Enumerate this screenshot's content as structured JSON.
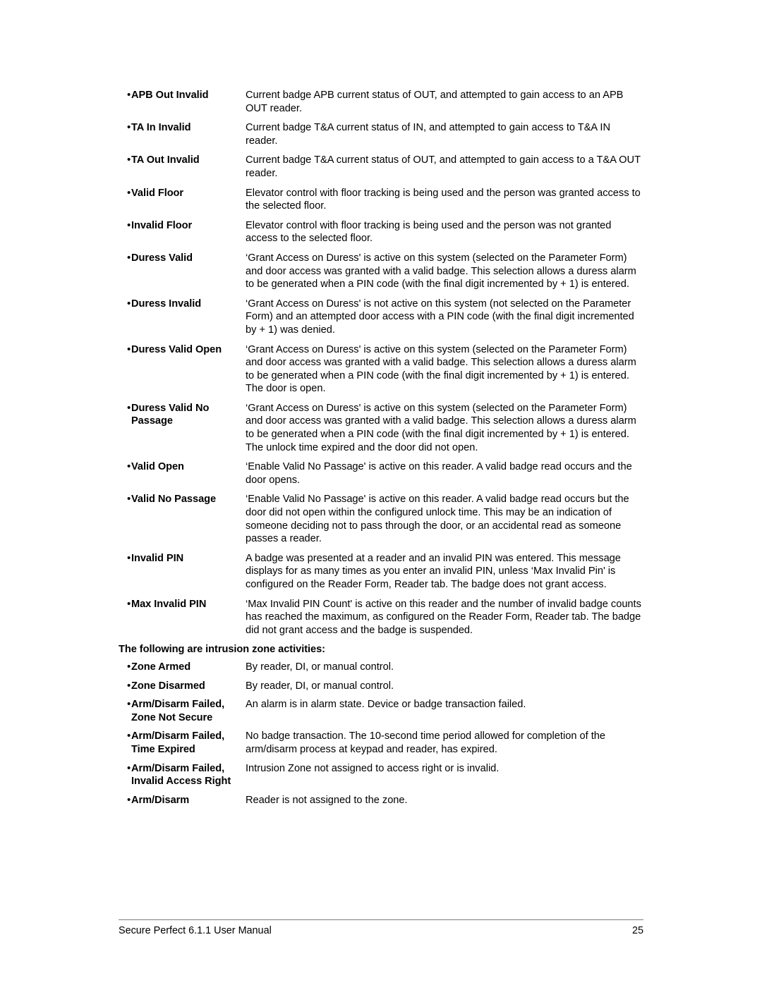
{
  "document": {
    "bullet_glyph": "•",
    "entries": [
      {
        "term": "APB Out Invalid",
        "description": "Current badge APB current status of OUT, and attempted to gain access to an APB OUT reader."
      },
      {
        "term": "TA In Invalid",
        "description": "Current badge T&A current status of IN, and attempted to gain access to T&A IN reader."
      },
      {
        "term": "TA Out Invalid",
        "description": "Current badge T&A current status of OUT, and attempted to gain access to a T&A OUT reader."
      },
      {
        "term": "Valid Floor",
        "description": "Elevator control with floor tracking is being used and the person was granted access to the selected floor."
      },
      {
        "term": "Invalid Floor",
        "description": "Elevator control with floor tracking is being used and the person was not granted access to the selected floor."
      },
      {
        "term": "Duress Valid",
        "description": "‘Grant Access on Duress' is active on this system (selected on the Parameter Form) and door access was granted with a valid badge. This selection allows a duress alarm to be generated when a PIN code (with the final digit incremented by + 1) is entered."
      },
      {
        "term": "Duress Invalid",
        "description": "‘Grant Access on Duress' is not active on this system (not selected on the Parameter Form) and an attempted door access with a PIN code (with the final digit incremented by + 1) was denied."
      },
      {
        "term": "Duress Valid Open",
        "description": "‘Grant Access on Duress' is active on this system (selected on the Parameter Form) and door access was granted with a valid badge. This selection allows a duress alarm to be generated when a PIN code (with the final digit incremented by + 1) is entered. The door is open."
      },
      {
        "term": "Duress Valid No Passage",
        "description": "‘Grant Access on Duress' is active on this system (selected on the Parameter Form) and door access was granted with a valid badge. This selection allows a duress alarm to be generated when a PIN code (with the final digit incremented by + 1) is entered. The unlock time expired and the door did not open."
      },
      {
        "term": "Valid Open",
        "description": "‘Enable Valid No Passage' is active on this reader. A valid badge read occurs and the door opens."
      },
      {
        "term": "Valid No Passage",
        "description": "‘Enable Valid No Passage' is active on this reader. A valid badge read occurs but the door did not open within the configured unlock time. This may be an indication of someone deciding not to pass through the door, or an accidental read as someone passes a reader."
      },
      {
        "term": "Invalid PIN",
        "description": "A badge was presented at a reader and an invalid PIN was entered. This message displays for as many times as you enter an invalid PIN, unless ‘Max Invalid Pin' is configured on the Reader Form, Reader tab. The badge does not grant access."
      },
      {
        "term": "Max Invalid PIN",
        "description": "‘Max Invalid PIN Count' is active on this reader and the number of invalid badge counts has reached the maximum, as configured on the Reader Form, Reader tab. The badge did not grant access and the badge is suspended."
      }
    ],
    "intrusion_heading": "The following are intrusion zone activities:",
    "intrusion_entries": [
      {
        "term": "Zone Armed",
        "description": "By reader, DI, or manual control."
      },
      {
        "term": "Zone Disarmed",
        "description": "By reader, DI, or manual control."
      },
      {
        "term": "Arm/Disarm Failed, Zone Not Secure",
        "description": "An alarm is in alarm state. Device or badge transaction failed."
      },
      {
        "term": "Arm/Disarm Failed, Time Expired",
        "description": "No badge transaction. The 10-second time period allowed for completion of the arm/disarm process at keypad and reader, has expired."
      },
      {
        "term": "Arm/Disarm Failed, Invalid Access Right",
        "description": "Intrusion Zone not assigned to access right or is invalid."
      },
      {
        "term": "Arm/Disarm",
        "description": "Reader is not assigned to the zone."
      }
    ]
  },
  "footer": {
    "title": "Secure Perfect 6.1.1 User Manual",
    "page_number": "25"
  }
}
